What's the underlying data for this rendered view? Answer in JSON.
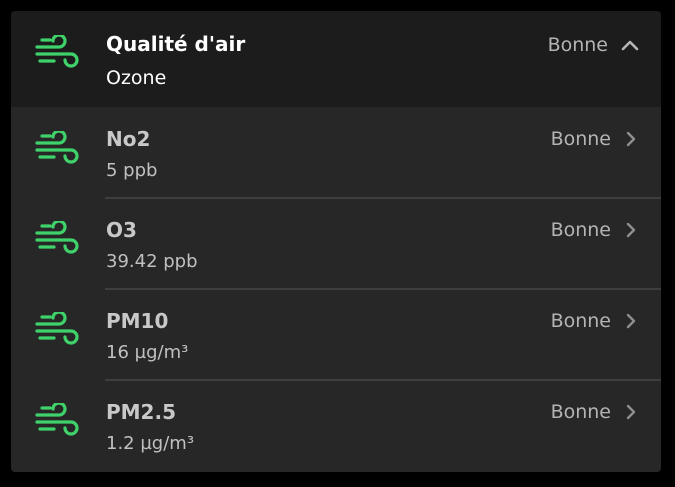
{
  "colors": {
    "accent": "#3fd26a",
    "background": "#000000",
    "panel": "#272727",
    "header": "#1c1c1c",
    "title_header": "#ffffff",
    "title_row": "#c8c8c8",
    "subtext": "#c0c0c0",
    "status": "#b4b4b4"
  },
  "header": {
    "title": "Qualité d'air",
    "subtitle": "Ozone",
    "status": "Bonne",
    "icon": "wind-icon",
    "toggle_icon": "chevron-up-icon"
  },
  "items": [
    {
      "label": "No2",
      "value": "5 ppb",
      "status": "Bonne",
      "icon": "wind-icon"
    },
    {
      "label": "O3",
      "value": "39.42 ppb",
      "status": "Bonne",
      "icon": "wind-icon"
    },
    {
      "label": "PM10",
      "value": "16 µg/m³",
      "status": "Bonne",
      "icon": "wind-icon"
    },
    {
      "label": "PM2.5",
      "value": "1.2 µg/m³",
      "status": "Bonne",
      "icon": "wind-icon"
    }
  ]
}
